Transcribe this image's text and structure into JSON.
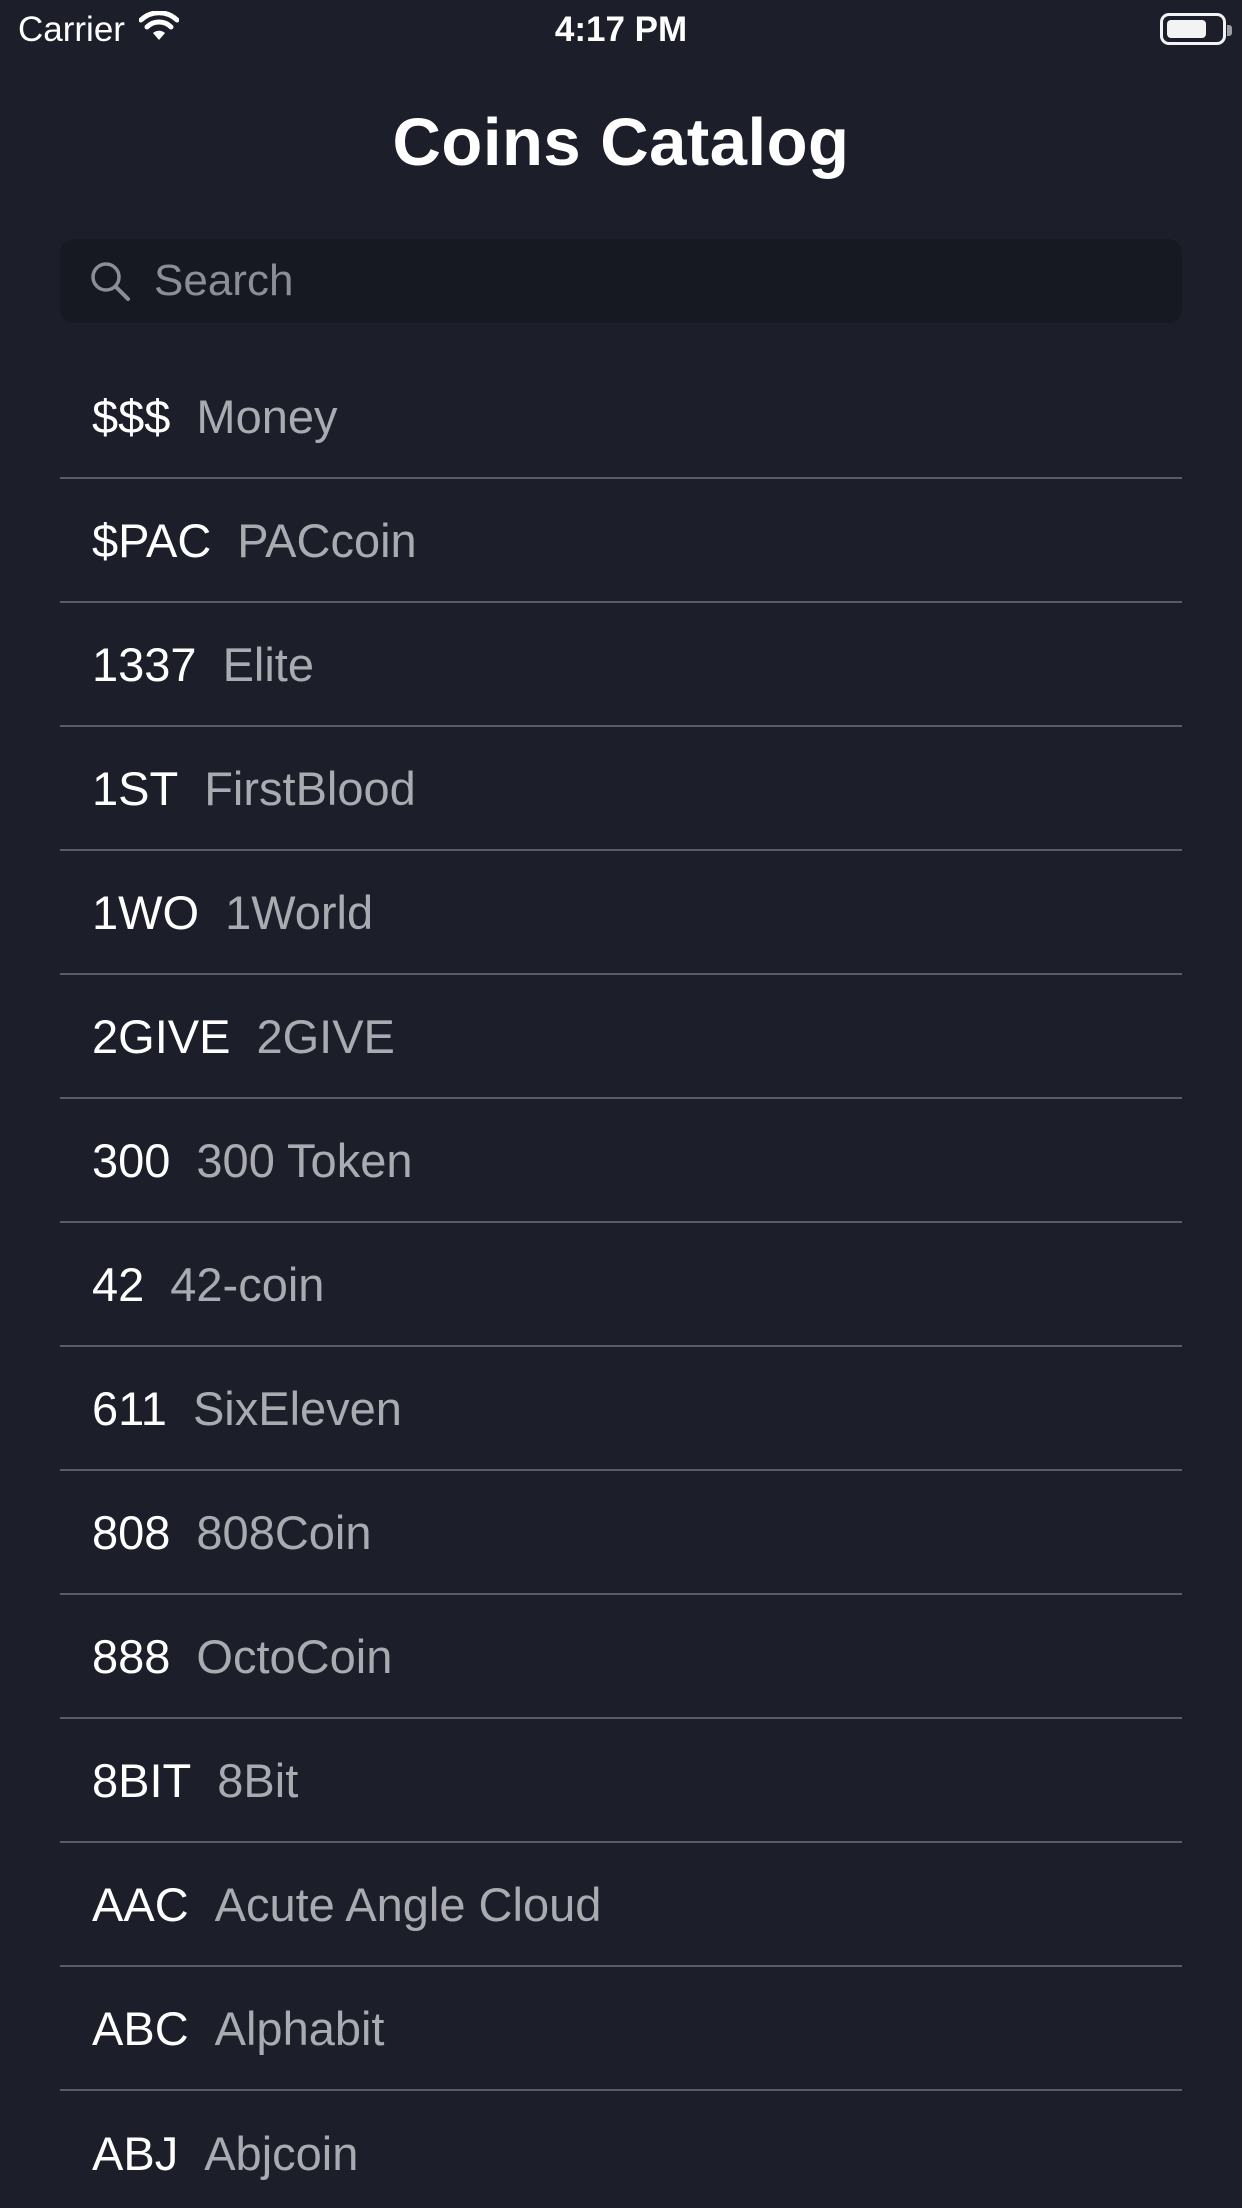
{
  "status_bar": {
    "carrier": "Carrier",
    "time": "4:17 PM",
    "battery_level": 0.75
  },
  "header": {
    "title": "Coins Catalog"
  },
  "search": {
    "placeholder": "Search",
    "value": ""
  },
  "coins": [
    {
      "symbol": "$$$",
      "name": "Money"
    },
    {
      "symbol": "$PAC",
      "name": "PACcoin"
    },
    {
      "symbol": "1337",
      "name": "Elite"
    },
    {
      "symbol": "1ST",
      "name": "FirstBlood"
    },
    {
      "symbol": "1WO",
      "name": "1World"
    },
    {
      "symbol": "2GIVE",
      "name": "2GIVE"
    },
    {
      "symbol": "300",
      "name": "300 Token"
    },
    {
      "symbol": "42",
      "name": "42-coin"
    },
    {
      "symbol": "611",
      "name": "SixEleven"
    },
    {
      "symbol": "808",
      "name": "808Coin"
    },
    {
      "symbol": "888",
      "name": "OctoCoin"
    },
    {
      "symbol": "8BIT",
      "name": "8Bit"
    },
    {
      "symbol": "AAC",
      "name": "Acute Angle Cloud"
    },
    {
      "symbol": "ABC",
      "name": "Alphabit"
    },
    {
      "symbol": "ABJ",
      "name": "Abjcoin"
    }
  ],
  "colors": {
    "background": "#1c1f29",
    "search_background": "#161922",
    "separator": "#5a5c63",
    "secondary_text": "#a9abb1"
  }
}
